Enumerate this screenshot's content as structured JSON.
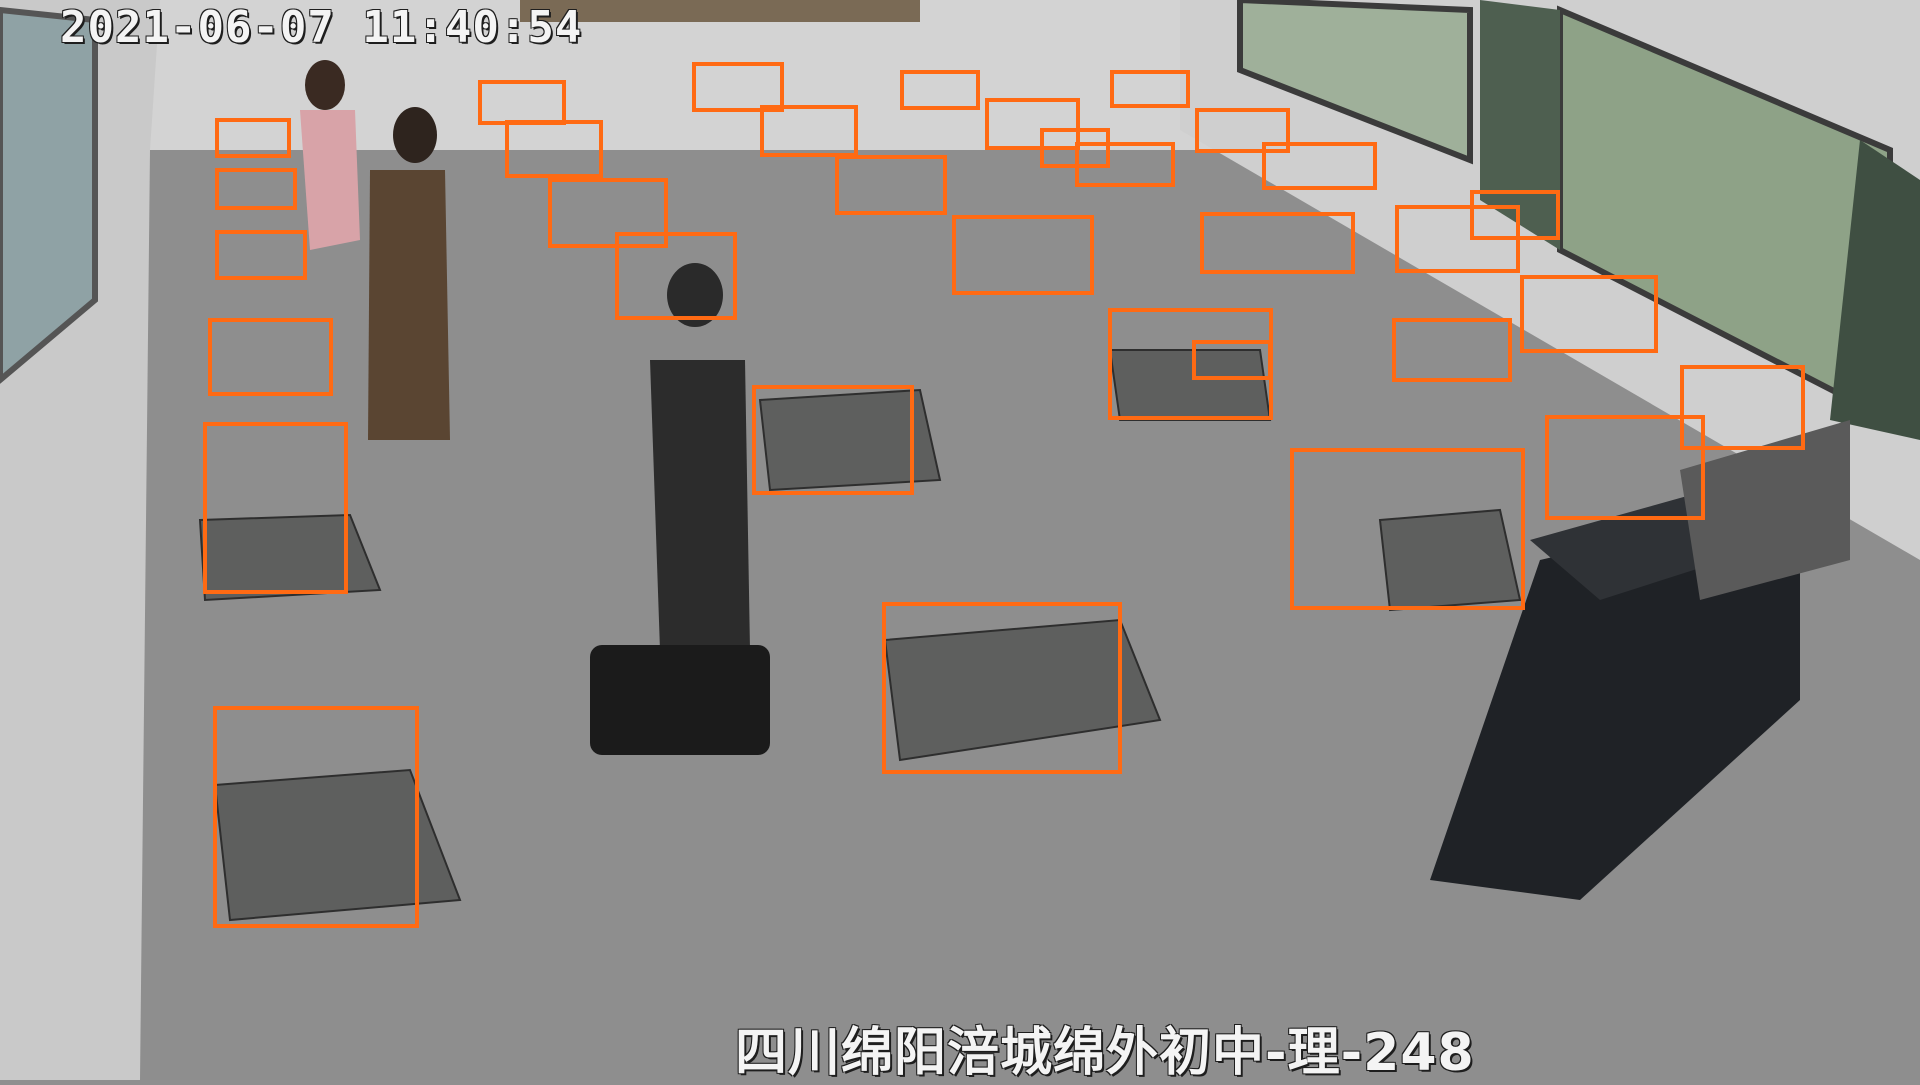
{
  "overlay": {
    "timestamp": "2021-06-07 11:40:54",
    "camera_label": "四川绵阳涪城绵外初中-理-248"
  },
  "detections": {
    "label": "desk",
    "box_color": "#ff6a13",
    "count": 33
  },
  "colors": {
    "floor": "#8e8e8e",
    "wall": "#d6d6d6",
    "desk_top": "#5e5f5e",
    "lectern": "#1f2226"
  }
}
